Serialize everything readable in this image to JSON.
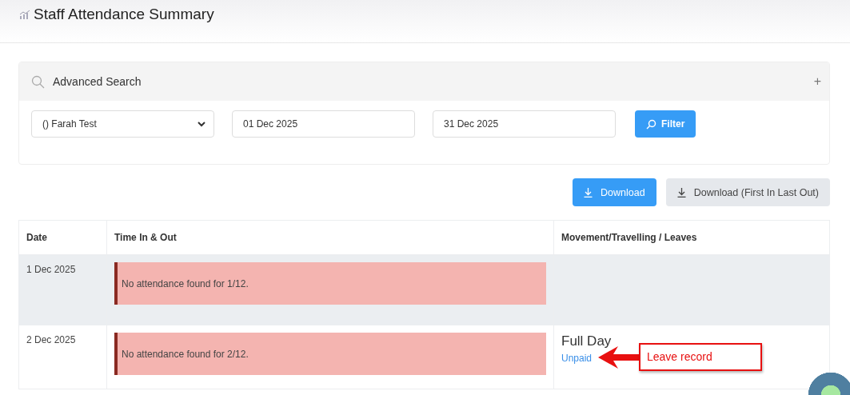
{
  "page": {
    "title": "Staff Attendance Summary"
  },
  "advanced_search": {
    "title": "Advanced Search",
    "expand_icon": "+",
    "staff": "() Farah Test",
    "from_date": "01 Dec 2025",
    "to_date": "31 Dec 2025",
    "filter_button": "Filter"
  },
  "actions": [
    {
      "label": "Download",
      "kind": "primary"
    },
    {
      "label": "Download (First In Last Out)",
      "kind": "secondary"
    }
  ],
  "table": {
    "columns": [
      "Date",
      "Time In & Out",
      "Movement/Travelling / Leaves"
    ],
    "rows": [
      {
        "date": "1 Dec 2025",
        "shaded": true,
        "message": "No attendance found for 1/12."
      },
      {
        "date": "2 Dec 2025",
        "shaded": false,
        "message": "No attendance found for 2/12.",
        "leave": {
          "duration": "Full Day",
          "type": "Unpaid"
        }
      }
    ]
  },
  "annotation": {
    "text": "Leave record"
  }
}
